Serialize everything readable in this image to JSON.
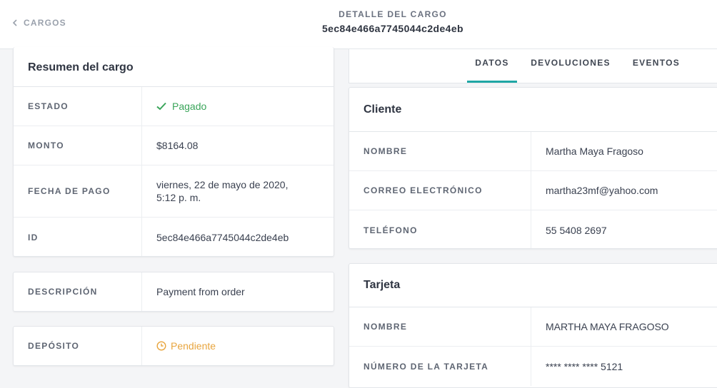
{
  "header": {
    "back_label": "CARGOS",
    "title": "DETALLE DEL CARGO",
    "charge_id": "5ec84e466a7745044c2de4eb"
  },
  "summary": {
    "title": "Resumen del cargo",
    "status_label": "ESTADO",
    "status_value": "Pagado",
    "amount_label": "MONTO",
    "amount_value": "$8164.08",
    "date_label": "FECHA DE PAGO",
    "date_line1": "viernes, 22 de mayo de 2020,",
    "date_line2": "5:12 p. m.",
    "id_label": "ID",
    "id_value": "5ec84e466a7745044c2de4eb"
  },
  "description": {
    "label": "DESCRIPCIÓN",
    "value": "Payment from order"
  },
  "deposit": {
    "label": "DEPÓSITO",
    "value": "Pendiente"
  },
  "tabs": [
    {
      "label": "DATOS",
      "active": true
    },
    {
      "label": "DEVOLUCIONES",
      "active": false
    },
    {
      "label": "EVENTOS",
      "active": false
    }
  ],
  "customer": {
    "title": "Cliente",
    "name_label": "NOMBRE",
    "name_value": "Martha Maya Fragoso",
    "email_label": "CORREO ELECTRÓNICO",
    "email_value": "martha23mf@yahoo.com",
    "phone_label": "TELÉFONO",
    "phone_value": "55 5408 2697"
  },
  "card": {
    "title": "Tarjeta",
    "name_label": "NOMBRE",
    "name_value": "MARTHA MAYA FRAGOSO",
    "number_label": "NÚMERO DE LA TARJETA",
    "number_value": "**** **** **** 5121"
  },
  "colors": {
    "success": "#3aa55a",
    "pending": "#e8a53e",
    "accent": "#1fa7a5"
  },
  "icons": {
    "back": "chevron-left-icon",
    "paid": "check-icon",
    "pending": "clock-icon"
  }
}
